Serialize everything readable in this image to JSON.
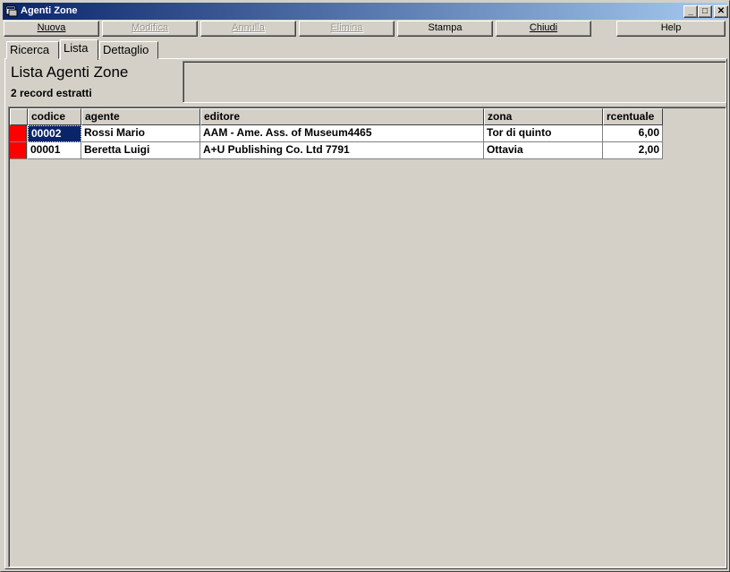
{
  "window": {
    "title": "Agenti Zone",
    "controls": {
      "minimize": "_",
      "maximize": "□",
      "close": "✕"
    }
  },
  "toolbar": {
    "nuova": {
      "label": "Nuova",
      "enabled": true
    },
    "modifica": {
      "label": "Modifica",
      "enabled": false
    },
    "annulla": {
      "label": "Annulla",
      "enabled": false
    },
    "elimina": {
      "label": "Elimina",
      "enabled": false
    },
    "stampa": {
      "label": "Stampa",
      "enabled": true
    },
    "chiudi": {
      "label": "Chiudi",
      "enabled": true
    },
    "help": {
      "label": "Help",
      "enabled": true
    }
  },
  "tabs": [
    {
      "label": "Ricerca",
      "active": false
    },
    {
      "label": "Lista",
      "active": true
    },
    {
      "label": "Dettaglio",
      "active": false
    }
  ],
  "page": {
    "title": "Lista Agenti Zone",
    "record_count": "2 record estratti"
  },
  "grid": {
    "columns": [
      "codice",
      "agente",
      "editore",
      "zona",
      "rcentuale"
    ],
    "rows": [
      {
        "codice": "00002",
        "agente": "Rossi Mario",
        "editore": "AAM - Ame. Ass. of Museum4465",
        "zona": "Tor di quinto",
        "percentuale": "6,00",
        "selected": true
      },
      {
        "codice": "00001",
        "agente": "Beretta Luigi",
        "editore": "A+U Publishing Co. Ltd 7791",
        "zona": "Ottavia",
        "percentuale": "2,00",
        "selected": false
      }
    ]
  },
  "colors": {
    "titlebar_start": "#0a246a",
    "titlebar_end": "#a6caf0",
    "selection": "#0a246a",
    "row_marker": "#ff0000",
    "face": "#d4d0c8"
  }
}
